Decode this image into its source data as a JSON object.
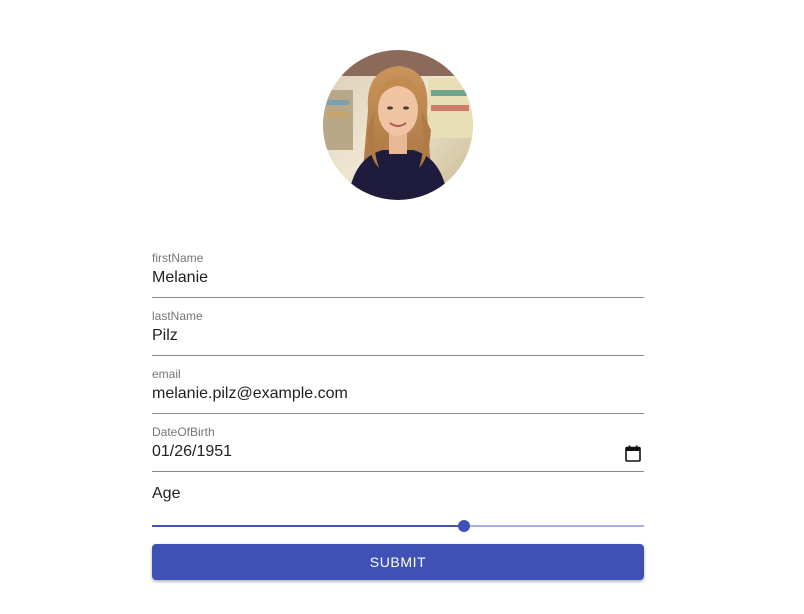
{
  "profile": {
    "avatar_description": "profile photo"
  },
  "form": {
    "first_name": {
      "label": "firstName",
      "value": "Melanie"
    },
    "last_name": {
      "label": "lastName",
      "value": "Pilz"
    },
    "email": {
      "label": "email",
      "value": "melanie.pilz@example.com"
    },
    "date_of_birth": {
      "label": "DateOfBirth",
      "value": "01/26/1951",
      "icon": "calendar-icon"
    },
    "age": {
      "label": "Age",
      "slider_fraction": 0.634
    },
    "submit_label": "Submit"
  },
  "colors": {
    "primary": "#3f51b5",
    "text": "#212121",
    "label": "#757575",
    "underline": "#8a8a8a"
  }
}
